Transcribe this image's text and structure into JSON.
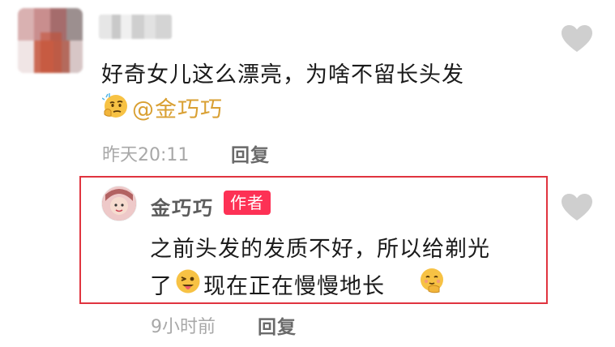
{
  "top_comment": {
    "text": "好奇女儿这么漂亮，为啥不留长头发",
    "mention": "@金巧巧",
    "time": "昨天20:11",
    "reply_label": "回复"
  },
  "reply_comment": {
    "author": "金巧巧",
    "badge": "作者",
    "line1": "之前头发的发质不好，所以给剃光",
    "line2_a": "了",
    "line2_b": "现在正在慢慢地长",
    "time": "9小时前",
    "reply_label": "回复"
  },
  "icons": [
    "like-heart-icon",
    "emoji-thinking-icon",
    "emoji-wink-tongue-icon",
    "emoji-shy-hand-icon"
  ],
  "colors": {
    "highlight_border": "#e0343f",
    "badge_bg": "#fd3155",
    "mention": "#d9a033",
    "heart": "#cfcfcf"
  }
}
